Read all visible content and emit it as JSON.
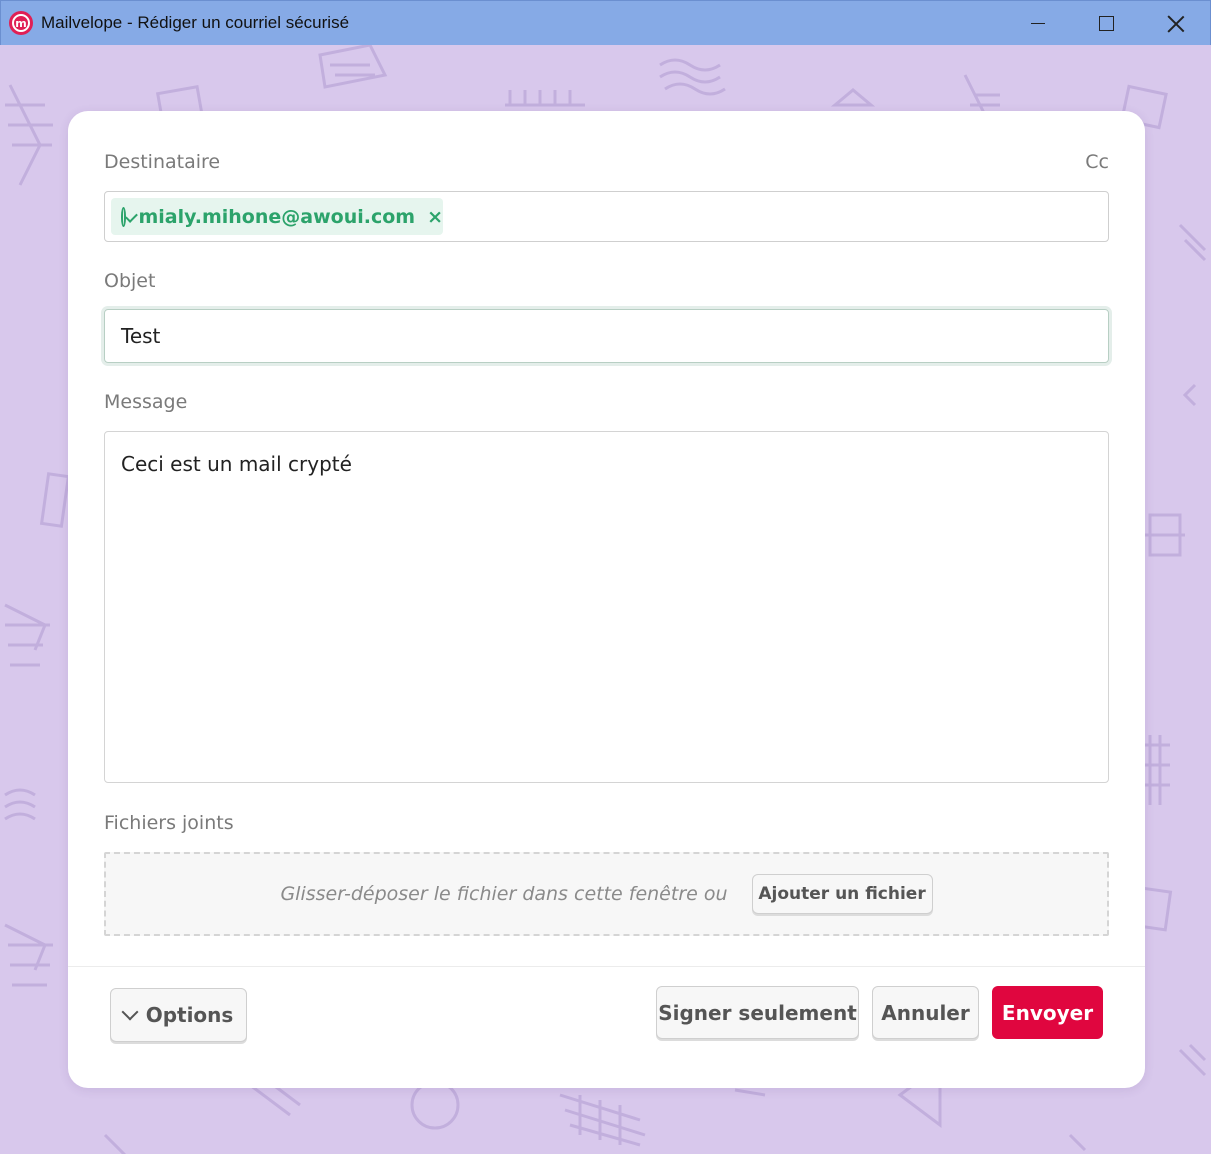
{
  "window": {
    "title": "Mailvelope - Rédiger un courriel sécurisé",
    "icon": "mailvelope-logo-icon",
    "logo_letter": "m"
  },
  "compose": {
    "recipient_label": "Destinataire",
    "cc_label": "Cc",
    "recipients": [
      {
        "email": "mialy.mihone@awoui.com",
        "status": "verified",
        "remove_glyph": "×"
      }
    ],
    "subject_label": "Objet",
    "subject_value": "Test",
    "message_label": "Message",
    "message_value": "Ceci est un mail crypté",
    "attachments_label": "Fichiers joints",
    "drop_hint": "Glisser-déposer le fichier dans cette fenêtre ou",
    "add_file_label": "Ajouter un fichier"
  },
  "footer": {
    "options_label": "Options",
    "sign_only_label": "Signer seulement",
    "cancel_label": "Annuler",
    "send_label": "Envoyer"
  },
  "colors": {
    "titlebar": "#86aae6",
    "background": "#d8c8ec",
    "accent_send": "#e0063f",
    "verified_green": "#2ca36b"
  }
}
